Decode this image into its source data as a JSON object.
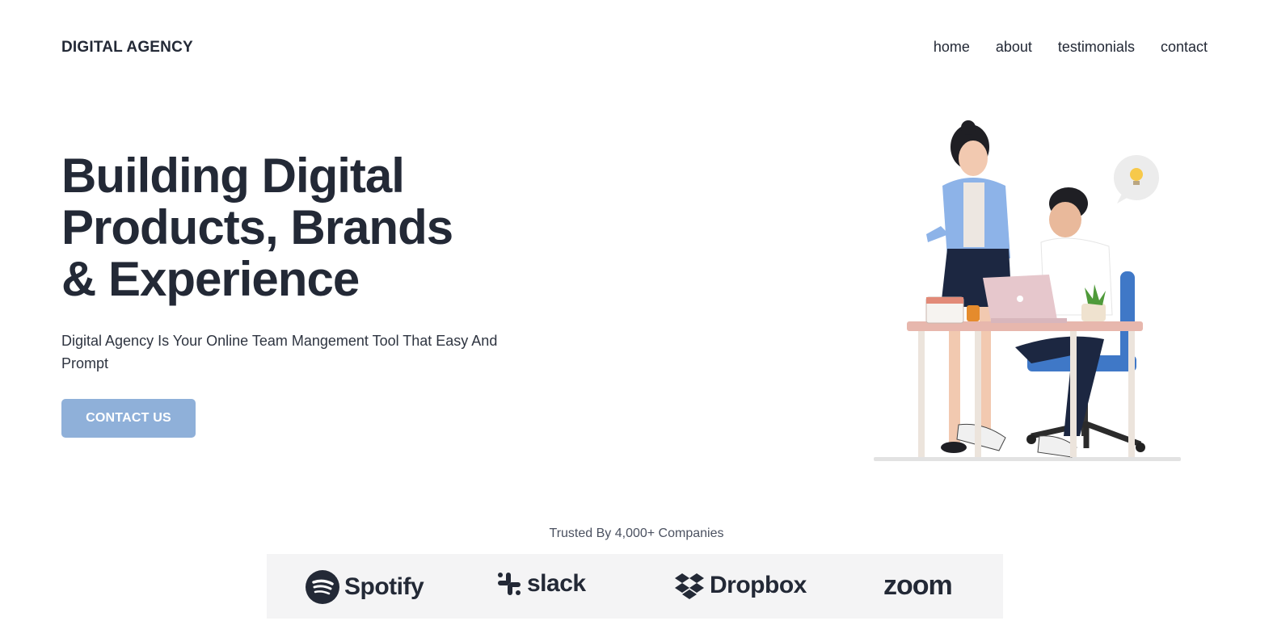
{
  "header": {
    "brand": "DIGITAL AGENCY",
    "nav": [
      "home",
      "about",
      "testimonials",
      "contact"
    ]
  },
  "hero": {
    "title_lines": [
      "Building Digital",
      "Products, Brands",
      "& Experience"
    ],
    "subtitle": "Digital Agency Is Your Online Team Mangement Tool That Easy And Prompt",
    "cta": "CONTACT US",
    "illustration_icon": "team-working-at-desk-illustration"
  },
  "trusted": {
    "label": "Trusted By 4,000+ Companies",
    "logos": [
      {
        "name": "Spotify",
        "icon": "spotify-icon"
      },
      {
        "name": "slack",
        "icon": "slack-icon"
      },
      {
        "name": "Dropbox",
        "icon": "dropbox-icon"
      },
      {
        "name": "zoom",
        "icon": "zoom-logo"
      }
    ]
  },
  "colors": {
    "text": "#232936",
    "cta_bg": "#8fb0d9",
    "logo_strip_bg": "#f4f4f5"
  }
}
